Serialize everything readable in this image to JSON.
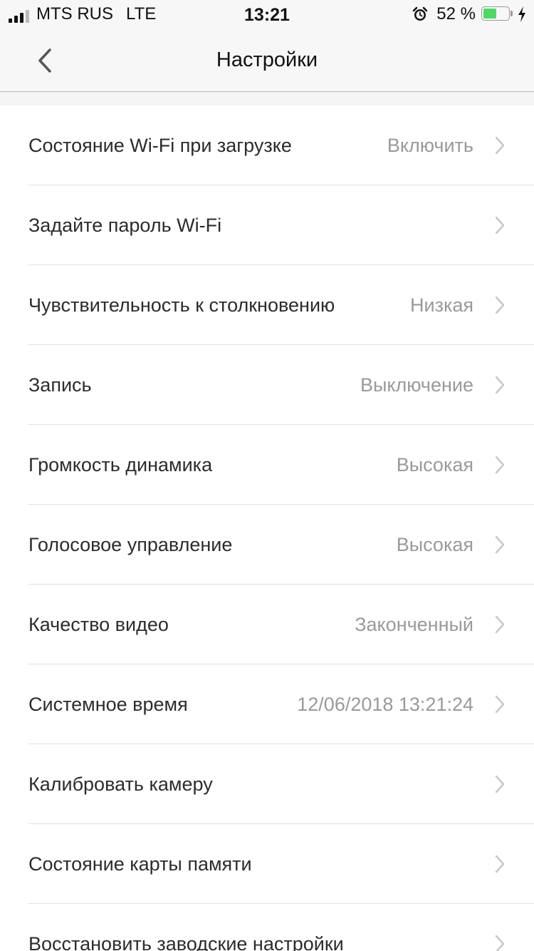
{
  "status_bar": {
    "carrier": "MTS RUS",
    "network": "LTE",
    "time": "13:21",
    "battery_percent_text": "52 %",
    "battery_level": 0.52,
    "icons": [
      "signal-icon",
      "alarm-icon",
      "battery-icon",
      "charging-icon"
    ],
    "battery_color": "#4cd964"
  },
  "nav": {
    "title": "Настройки",
    "back_icon": "chevron-left-icon"
  },
  "settings": [
    {
      "label": "Состояние Wi-Fi при загрузке",
      "value": "Включить"
    },
    {
      "label": "Задайте пароль Wi-Fi",
      "value": ""
    },
    {
      "label": "Чувствительность к столкновению",
      "value": "Низкая"
    },
    {
      "label": "Запись",
      "value": "Выключение"
    },
    {
      "label": "Громкость динамика",
      "value": "Высокая"
    },
    {
      "label": "Голосовое управление",
      "value": "Высокая"
    },
    {
      "label": "Качество видео",
      "value": "Законченный"
    },
    {
      "label": "Системное время",
      "value": "12/06/2018 13:21:24"
    },
    {
      "label": "Калибровать камеру",
      "value": ""
    },
    {
      "label": "Состояние карты памяти",
      "value": ""
    },
    {
      "label": "Восстановить заводские настройки",
      "value": ""
    }
  ],
  "colors": {
    "label": "#2c2c2c",
    "value": "#9a9a9a",
    "chevron": "#c7c7cc",
    "separator": "#e1e1e1"
  }
}
